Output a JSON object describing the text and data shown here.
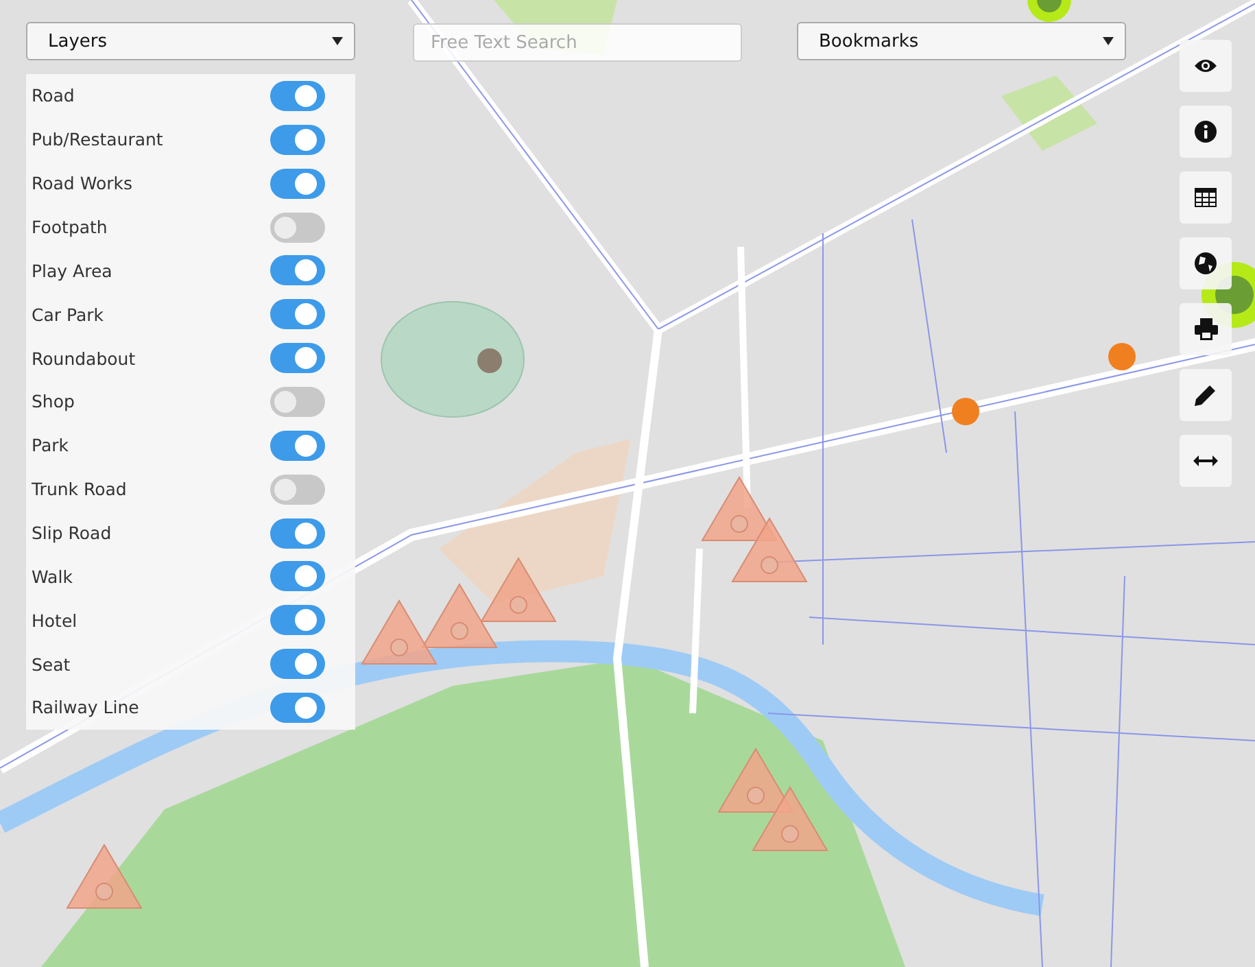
{
  "layers_select": {
    "label": "Layers"
  },
  "search": {
    "placeholder": "Free Text Search"
  },
  "bookmarks_select": {
    "label": "Bookmarks"
  },
  "layers": [
    {
      "name": "Road",
      "on": true
    },
    {
      "name": "Pub/Restaurant",
      "on": true
    },
    {
      "name": "Road Works",
      "on": true
    },
    {
      "name": "Footpath",
      "on": false
    },
    {
      "name": "Play Area",
      "on": true
    },
    {
      "name": "Car Park",
      "on": true
    },
    {
      "name": "Roundabout",
      "on": true
    },
    {
      "name": "Shop",
      "on": false
    },
    {
      "name": "Park",
      "on": true
    },
    {
      "name": "Trunk Road",
      "on": false
    },
    {
      "name": "Slip Road",
      "on": true
    },
    {
      "name": "Walk",
      "on": true
    },
    {
      "name": "Hotel",
      "on": true
    },
    {
      "name": "Seat",
      "on": true
    },
    {
      "name": "Railway Line",
      "on": true
    }
  ]
}
